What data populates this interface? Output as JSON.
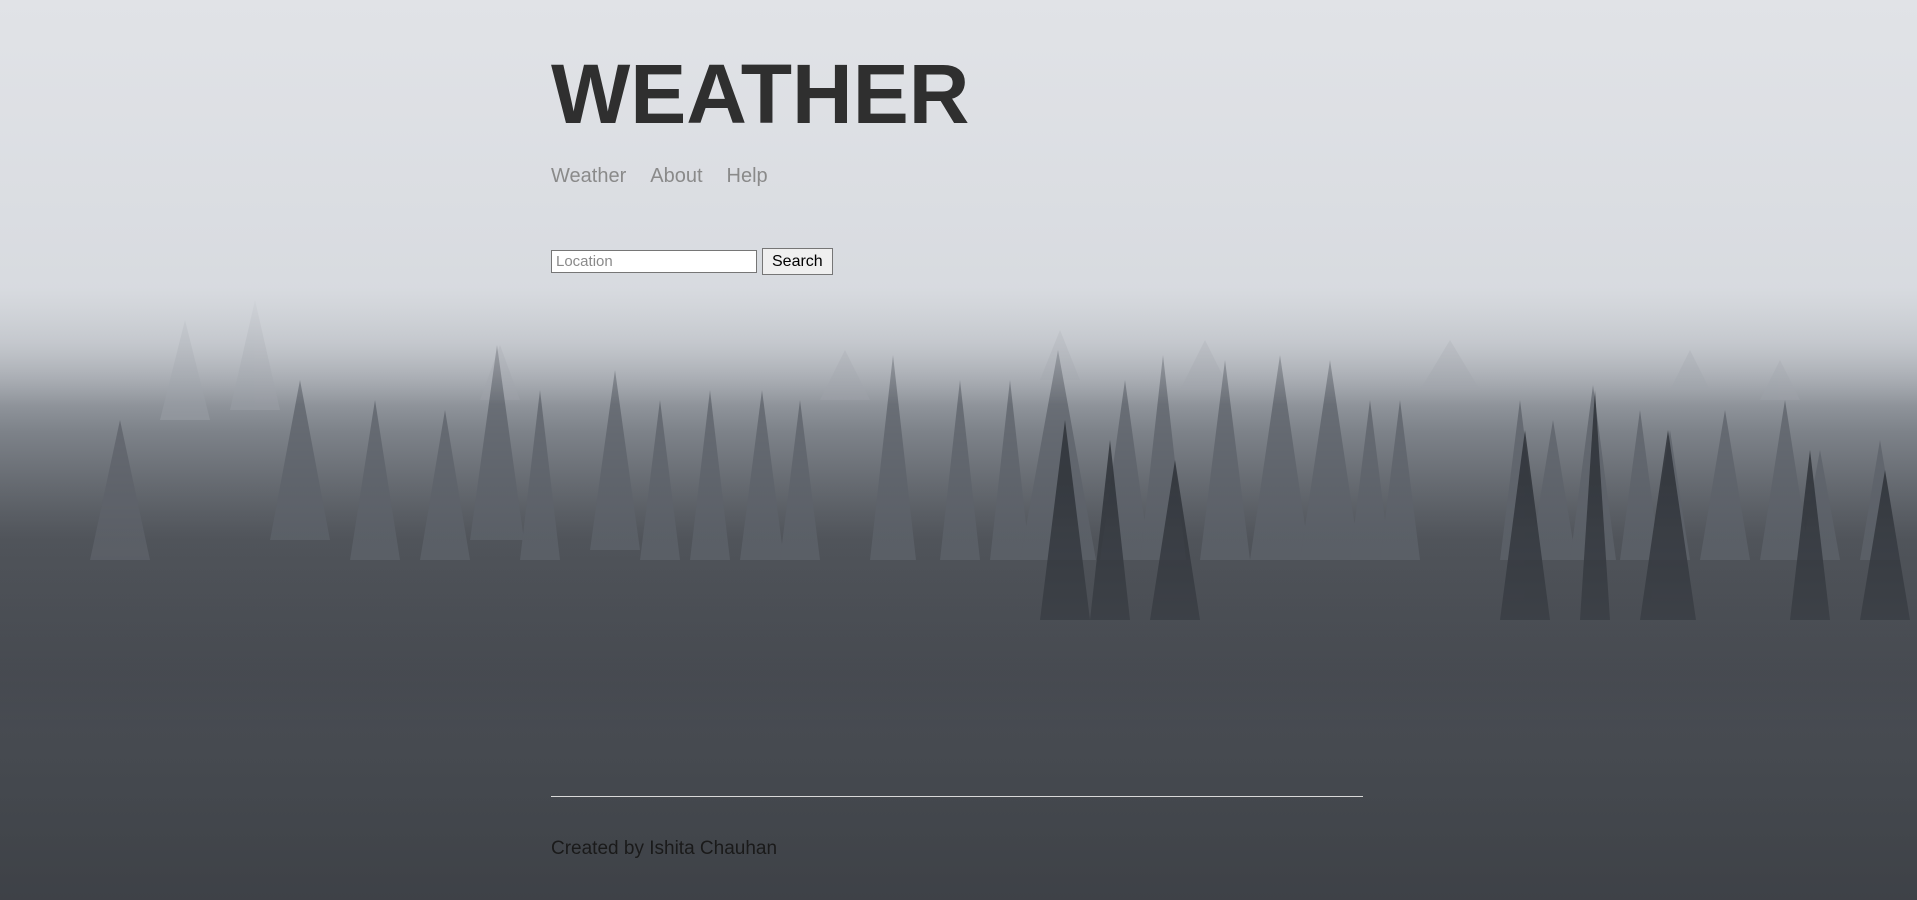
{
  "header": {
    "title": "WEATHER"
  },
  "nav": {
    "items": [
      {
        "label": "Weather"
      },
      {
        "label": "About"
      },
      {
        "label": "Help"
      }
    ]
  },
  "search": {
    "placeholder": "Location",
    "value": "",
    "button_label": "Search"
  },
  "footer": {
    "text": "Created by Ishita Chauhan"
  },
  "colors": {
    "title": "#2f2f2f",
    "nav_link": "#8a8a8a",
    "fog_top": "#dcdfe4",
    "forest_dark": "#2e3136"
  },
  "background": {
    "icon": "foggy-forest-background"
  }
}
